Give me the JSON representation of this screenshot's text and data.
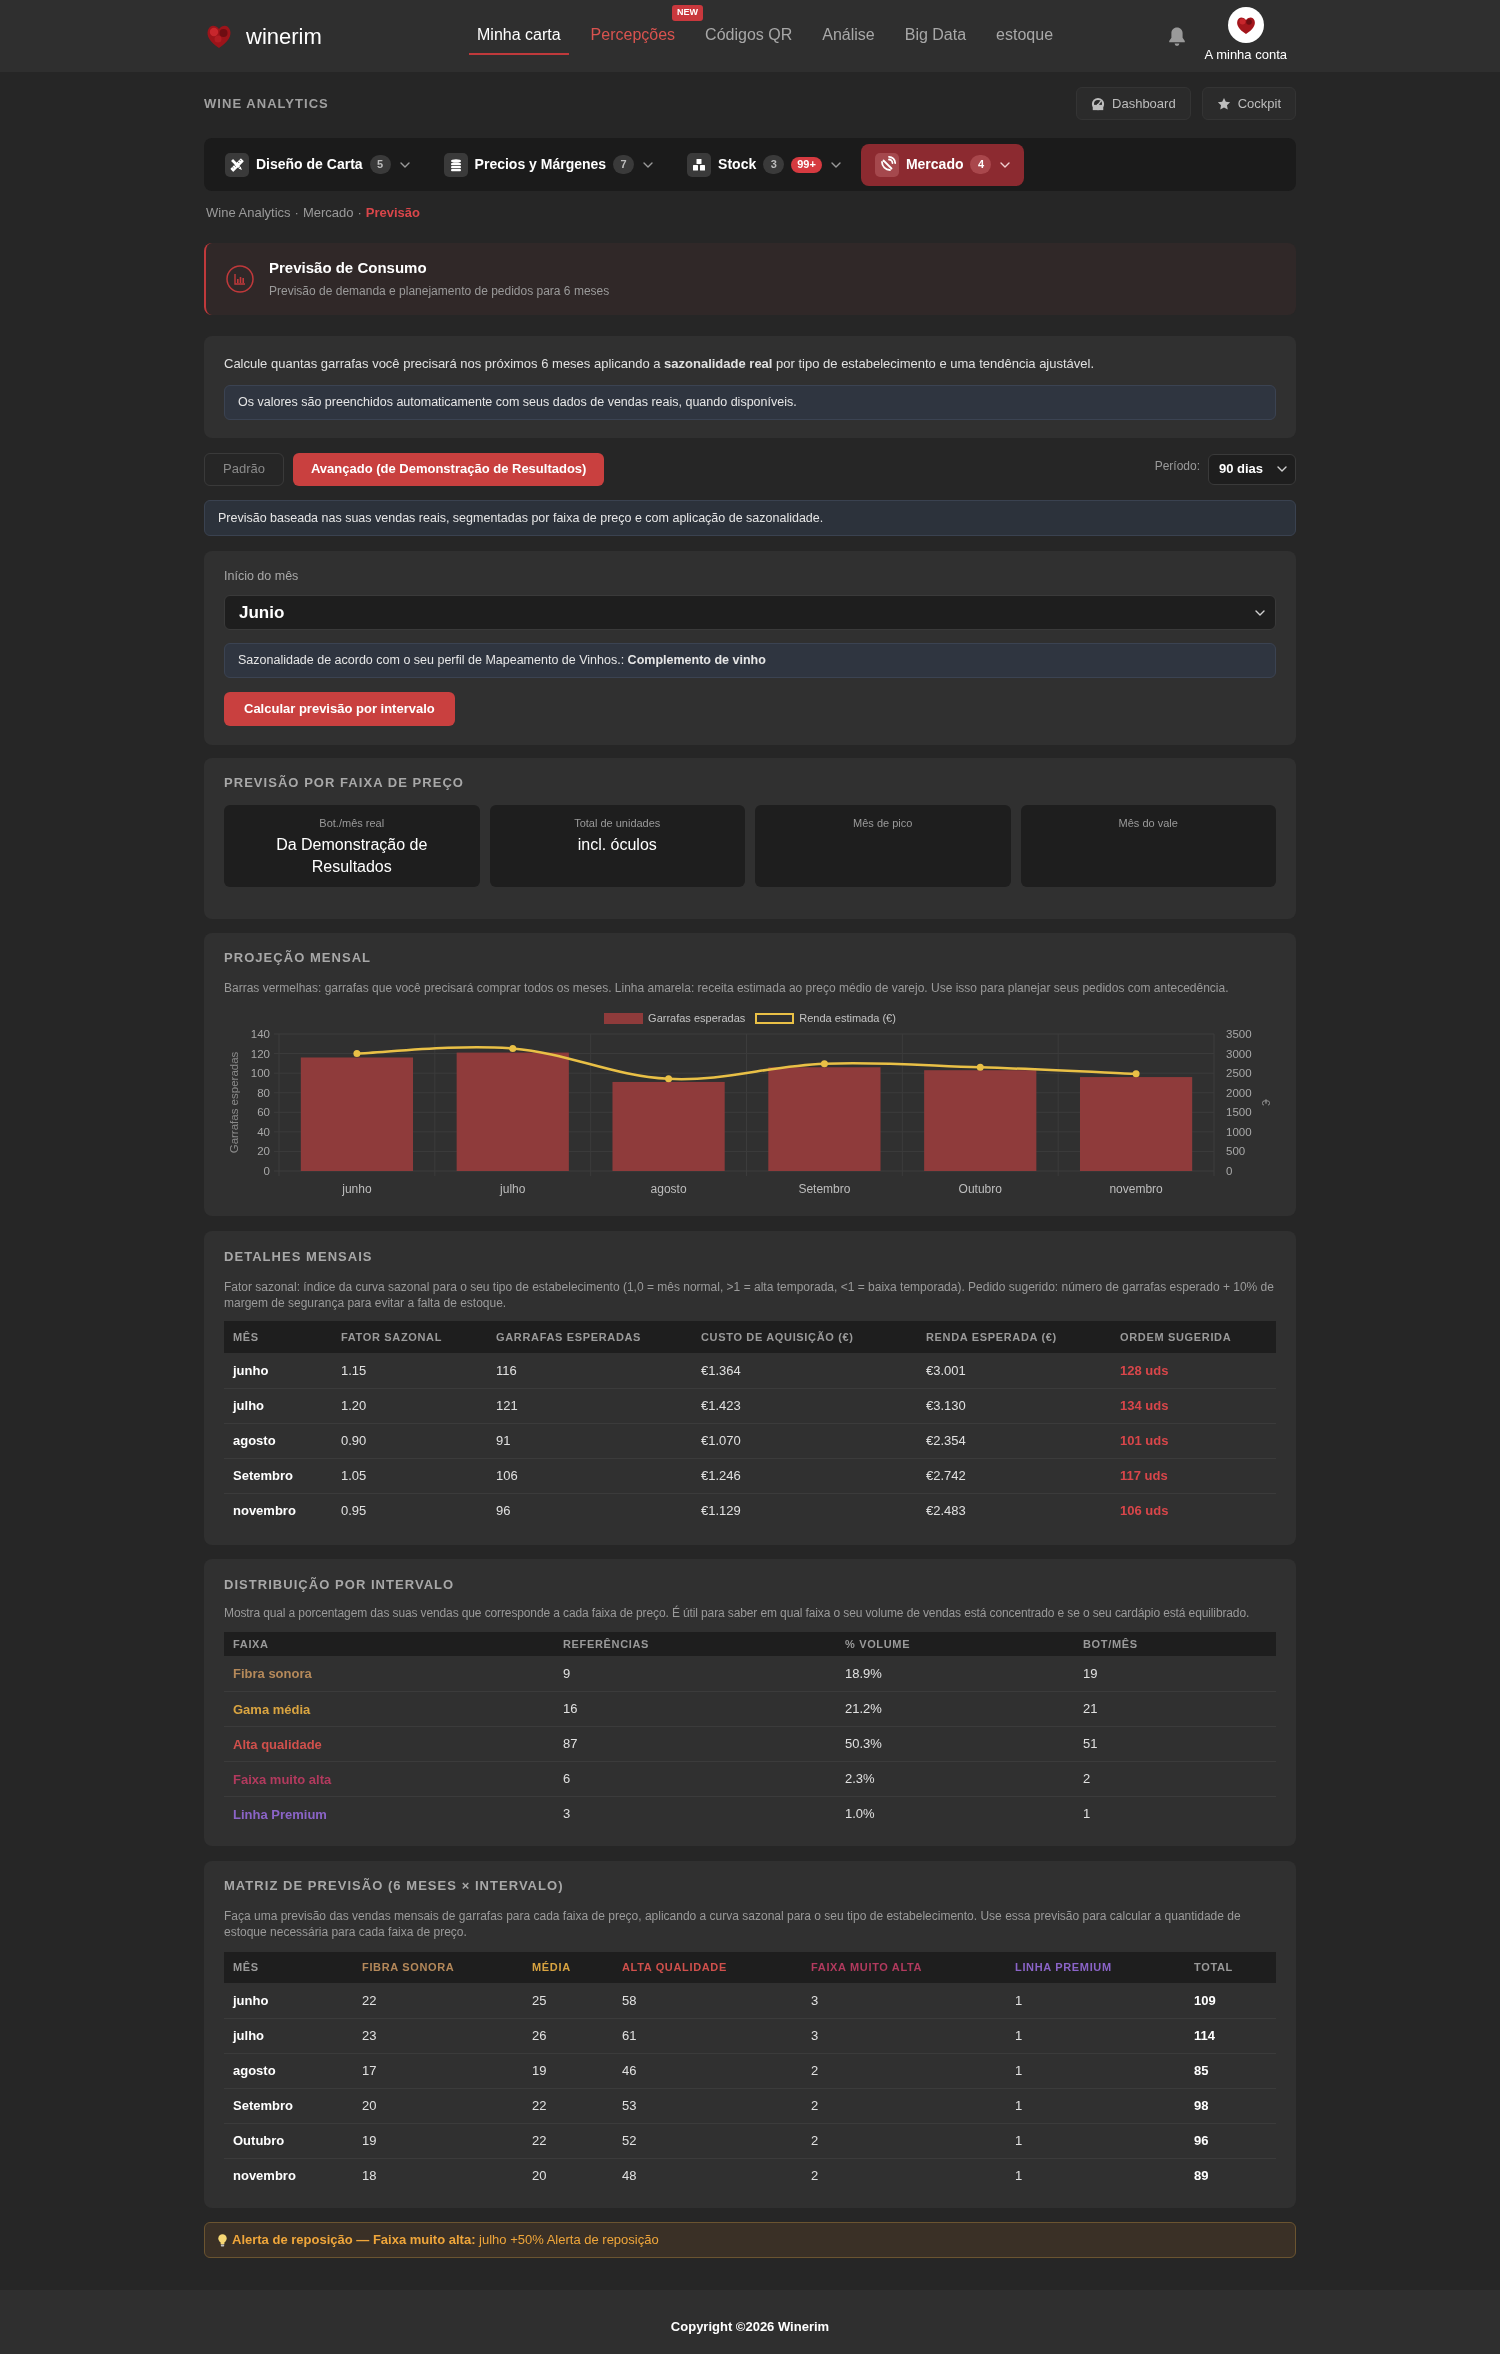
{
  "top_nav": {
    "brand": "winerim",
    "links": [
      {
        "label": "Minha carta",
        "selected": true,
        "kind": "link"
      },
      {
        "label": "Percepções",
        "selected": false,
        "kind": "featured",
        "badge": "NEW"
      },
      {
        "label": "Códigos QR",
        "selected": false,
        "kind": "link"
      },
      {
        "label": "Análise",
        "selected": false,
        "kind": "link"
      },
      {
        "label": "Big Data",
        "selected": false,
        "kind": "link"
      },
      {
        "label": "estoque",
        "selected": false,
        "kind": "link"
      }
    ],
    "account": "A minha conta"
  },
  "page_header": {
    "section": "WINE ANALYTICS",
    "buttons": [
      "Dashboard",
      "Cockpit"
    ]
  },
  "module_tabs": [
    {
      "label": "Diseño de Carta",
      "count": "5",
      "selected": false
    },
    {
      "label": "Precios y Márgenes",
      "count": "7",
      "selected": false
    },
    {
      "label": "Stock",
      "count": "3",
      "alert": "99+",
      "selected": false
    },
    {
      "label": "Mercado",
      "count": "4",
      "selected": true
    }
  ],
  "breadcrumb": {
    "separator": "·",
    "items": [
      {
        "label": "Wine Analytics",
        "current": false
      },
      {
        "label": "Mercado",
        "current": false
      },
      {
        "label": "Previsão",
        "current": true
      }
    ]
  },
  "hero": {
    "title": "Previsão de Consumo",
    "subtitle": "Previsão de demanda e planejamento de pedidos para 6 meses"
  },
  "intro": {
    "text": "Calcule quantas garrafas você precisará nos próximos 6 meses aplicando a **sazonalidade real** por tipo de estabelecimento e uma tendência ajustável.",
    "note": "Os valores são preenchidos automaticamente com seus dados de vendas reais, quando disponíveis."
  },
  "mode_tabs": [
    {
      "label": "Padrão",
      "selected": false
    },
    {
      "label": "Avançado (de Demonstração de Resultados)",
      "selected": true
    }
  ],
  "period": {
    "label": "Período:",
    "value": "90 dias"
  },
  "mode_info": "Previsão baseada nas suas vendas reais, segmentadas por faixa de preço e com aplicação de sazonalidade.",
  "form": {
    "month_label": "Início do mês",
    "month_value": "Junio",
    "season_note": "Sazonalidade de acordo com o seu perfil de Mapeamento de Vinhos.: **Complemento de vinho**",
    "button": "Calcular previsão por intervalo"
  },
  "price_forecast": {
    "title": "PREVISÃO POR FAIXA DE PREÇO",
    "tiles": [
      {
        "label": "Bot./mês real",
        "value": "Da Demonstração de Resultados"
      },
      {
        "label": "Total de unidades",
        "value": "incl. óculos"
      },
      {
        "label": "Mês de pico"
      },
      {
        "label": "Mês do vale"
      }
    ]
  },
  "monthly_projection": {
    "title": "PROJEÇÃO MENSAL",
    "description": "Barras vermelhas: garrafas que você precisará comprar todos os meses. Linha amarela: receita estimada ao preço médio de varejo. Use isso para planejar seus pedidos com antecedência.",
    "chart_data": {
      "type": "bar",
      "legend": "top",
      "grid": true,
      "categories": [
        "junho",
        "julho",
        "agosto",
        "Setembro",
        "Outubro",
        "novembro"
      ],
      "ylabel": "Garrafas esperadas",
      "y2label": "€",
      "ylim": [
        0,
        140
      ],
      "yticks": [
        0,
        20,
        40,
        60,
        80,
        100,
        120,
        140
      ],
      "y2lim": [
        0,
        3500
      ],
      "y2ticks": [
        0,
        500,
        1000,
        1500,
        2000,
        2500,
        3000,
        3500
      ],
      "series": [
        {
          "name": "Garrafas esperadas",
          "color": "#8f3b3b",
          "values": [
            116,
            121,
            91,
            106,
            103,
            96
          ]
        },
        {
          "name": "Renda estimada (€)",
          "type": "line",
          "marker": "circle",
          "axis": "y2",
          "color": "#e9c046",
          "values": [
            3001,
            3130,
            2354,
            2742,
            2650,
            2483
          ]
        }
      ]
    }
  },
  "monthly_details": {
    "title": "DETALHES MENSAIS",
    "description": "Fator sazonal: índice da curva sazonal para o seu tipo de estabelecimento (1,0 = mês normal, >1 = alta temporada, <1 = baixa temporada). Pedido sugerido: número de garrafas esperado + 10% de margem de segurança para evitar a falta de estoque.",
    "columns": [
      "MÊS",
      "FATOR SAZONAL",
      "GARRAFAS ESPERADAS",
      "CUSTO DE AQUISIÇÃO (€)",
      "RENDA ESPERADA (€)",
      "ORDEM SUGERIDA"
    ],
    "rows": [
      [
        "junho",
        "1.15",
        "116",
        "€1.364",
        "€3.001",
        "128 uds"
      ],
      [
        "julho",
        "1.20",
        "121",
        "€1.423",
        "€3.130",
        "134 uds"
      ],
      [
        "agosto",
        "0.90",
        "91",
        "€1.070",
        "€2.354",
        "101 uds"
      ],
      [
        "Setembro",
        "1.05",
        "106",
        "€1.246",
        "€2.742",
        "117 uds"
      ],
      [
        "novembro",
        "0.95",
        "96",
        "€1.129",
        "€2.483",
        "106 uds"
      ]
    ]
  },
  "distribution": {
    "title": "DISTRIBUIÇÃO POR INTERVALO",
    "description": "Mostra qual a porcentagem das suas vendas que corresponde a cada faixa de preço. É útil para saber em qual faixa o seu volume de vendas está concentrado e se o seu cardápio está equilibrado.",
    "columns": [
      "FAIXA",
      "REFERÊNCIAS",
      "% VOLUME",
      "BOT/MÊS"
    ],
    "rows": [
      {
        "color": "#b5895a",
        "cells": [
          "Fibra sonora",
          "9",
          "18.9%",
          "19"
        ]
      },
      {
        "color": "#d9a441",
        "cells": [
          "Gama média",
          "16",
          "21.2%",
          "21"
        ]
      },
      {
        "color": "#d0504c",
        "cells": [
          "Alta qualidade",
          "87",
          "50.3%",
          "51"
        ]
      },
      {
        "color": "#b23a5e",
        "cells": [
          "Faixa muito alta",
          "6",
          "2.3%",
          "2"
        ]
      },
      {
        "color": "#8b64c8",
        "cells": [
          "Linha Premium",
          "3",
          "1.0%",
          "1"
        ]
      }
    ]
  },
  "matrix": {
    "title": "MATRIZ DE PREVISÃO (6 MESES × INTERVALO)",
    "description": "Faça uma previsão das vendas mensais de garrafas para cada faixa de preço, aplicando a curva sazonal para o seu tipo de estabelecimento. Use essa previsão para calcular a quantidade de estoque necessária para cada faixa de preço.",
    "columns": [
      {
        "label": "MÊS"
      },
      {
        "label": "FIBRA SONORA",
        "color": "#b5895a"
      },
      {
        "label": "MÉDIA",
        "color": "#d9a441"
      },
      {
        "label": "ALTA QUALIDADE",
        "color": "#d0504c"
      },
      {
        "label": "FAIXA MUITO ALTA",
        "color": "#b23a5e"
      },
      {
        "label": "LINHA PREMIUM",
        "color": "#8b64c8"
      },
      {
        "label": "TOTAL"
      }
    ],
    "rows": [
      [
        "junho",
        "22",
        "25",
        "58",
        "3",
        "1",
        "109"
      ],
      [
        "julho",
        "23",
        "26",
        "61",
        "3",
        "1",
        "114"
      ],
      [
        "agosto",
        "17",
        "19",
        "46",
        "2",
        "1",
        "85"
      ],
      [
        "Setembro",
        "20",
        "22",
        "53",
        "2",
        "1",
        "98"
      ],
      [
        "Outubro",
        "19",
        "22",
        "52",
        "2",
        "1",
        "96"
      ],
      [
        "novembro",
        "18",
        "20",
        "48",
        "2",
        "1",
        "89"
      ]
    ]
  },
  "alert": "**Alerta de reposição — Faixa muito alta:** julho +50% Alerta de reposição",
  "footer": "Copyright ©2026 Winerim"
}
